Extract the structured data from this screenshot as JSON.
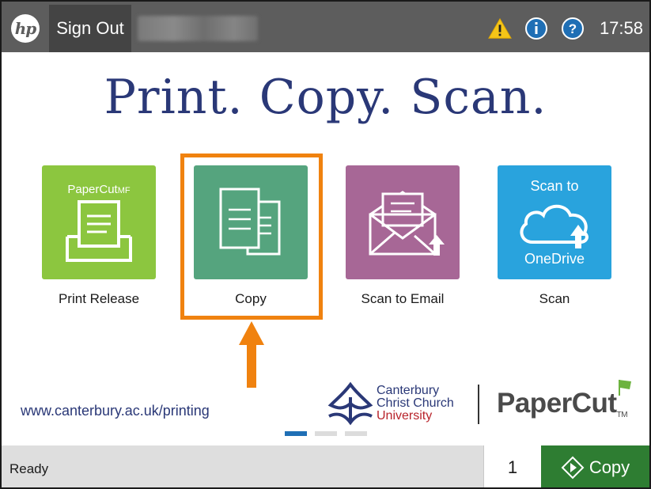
{
  "topbar": {
    "logo_text": "hp",
    "signout_label": "Sign Out",
    "time": "17:58",
    "icons": [
      "warning-icon",
      "info-icon",
      "help-icon"
    ]
  },
  "headline": "Print. Copy. Scan.",
  "tiles": [
    {
      "label": "Print Release",
      "color": "#8cc63f",
      "brand_text": "PaperCut",
      "brand_suffix": "MF"
    },
    {
      "label": "Copy",
      "color": "#55a47e",
      "selected": true
    },
    {
      "label": "Scan to Email",
      "color": "#a76796"
    },
    {
      "label": "Scan",
      "color": "#29a3dd",
      "top_text": "Scan to",
      "bottom_text": "OneDrive"
    }
  ],
  "footer": {
    "url": "www.canterbury.ac.uk/printing",
    "university_line1": "Canterbury",
    "university_line2": "Christ Church",
    "university_line3": "University",
    "papercut": "PaperCut",
    "papercut_tm": "TM"
  },
  "pager": {
    "pages": 3,
    "active": 0
  },
  "bottombar": {
    "status": "Ready",
    "copies": "1",
    "copy_button_label": "Copy"
  },
  "colors": {
    "accent_orange": "#f0820f",
    "navy": "#2a3877",
    "copy_green": "#2e7d32",
    "topbar_gray": "#5d5d5d"
  }
}
